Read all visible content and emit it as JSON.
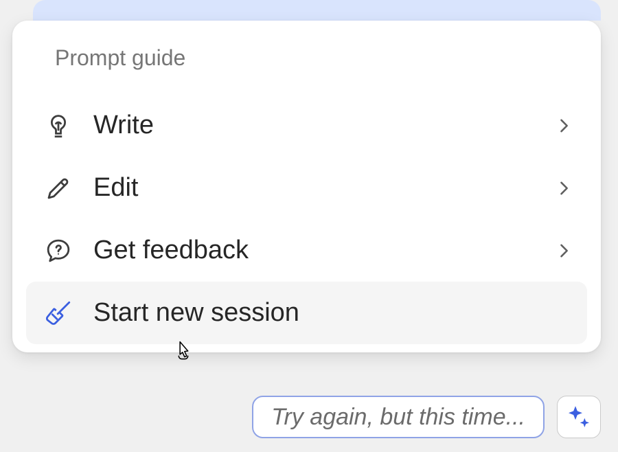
{
  "menu": {
    "title": "Prompt guide",
    "items": [
      {
        "icon": "lightbulb",
        "label": "Write",
        "hasChevron": true,
        "hovered": false
      },
      {
        "icon": "pencil",
        "label": "Edit",
        "hasChevron": true,
        "hovered": false
      },
      {
        "icon": "chat-question",
        "label": "Get feedback",
        "hasChevron": true,
        "hovered": false
      },
      {
        "icon": "broom",
        "label": "Start new session",
        "hasChevron": false,
        "hovered": true
      }
    ]
  },
  "input": {
    "placeholder": "Try again, but this time..."
  }
}
